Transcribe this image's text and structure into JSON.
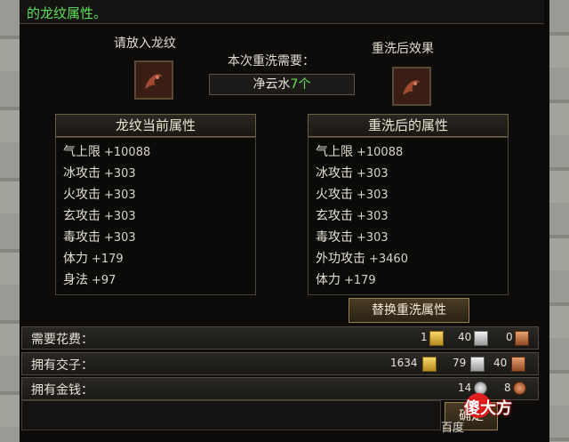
{
  "header": {
    "text": "的龙纹属性。"
  },
  "put_slot": {
    "label": "请放入龙纹"
  },
  "cost": {
    "label": "本次重洗需要：",
    "item_name": "净云水",
    "item_count": "7个"
  },
  "result_slot": {
    "label": "重洗后效果"
  },
  "current_attrs": {
    "title": "龙纹当前属性",
    "items": [
      {
        "name": "气上限",
        "value": "+10088"
      },
      {
        "name": "冰攻击",
        "value": "+303"
      },
      {
        "name": "火攻击",
        "value": "+303"
      },
      {
        "name": "玄攻击",
        "value": "+303"
      },
      {
        "name": "毒攻击",
        "value": "+303"
      },
      {
        "name": "体力",
        "value": "+179"
      },
      {
        "name": "身法",
        "value": "+97"
      }
    ]
  },
  "new_attrs": {
    "title": "重洗后的属性",
    "items": [
      {
        "name": "气上限",
        "value": "+10088"
      },
      {
        "name": "冰攻击",
        "value": "+303"
      },
      {
        "name": "火攻击",
        "value": "+303"
      },
      {
        "name": "玄攻击",
        "value": "+303"
      },
      {
        "name": "毒攻击",
        "value": "+303"
      },
      {
        "name": "外功攻击",
        "value": "+3460"
      },
      {
        "name": "体力",
        "value": "+179"
      }
    ]
  },
  "replace_button": {
    "label": "替换重洗属性"
  },
  "cost_row": {
    "label": "需要花费：",
    "gold": "1",
    "silver": "40",
    "copper": "0"
  },
  "owned_jiaozi": {
    "label": "拥有交子：",
    "gold": "1634",
    "silver": "79",
    "copper": "40"
  },
  "owned_money": {
    "label": "拥有金钱：",
    "silver": "14",
    "copper": "8"
  },
  "confirm_button": {
    "label": "确定"
  },
  "watermark": {
    "baidu": "百度",
    "brand": "傻大方"
  }
}
